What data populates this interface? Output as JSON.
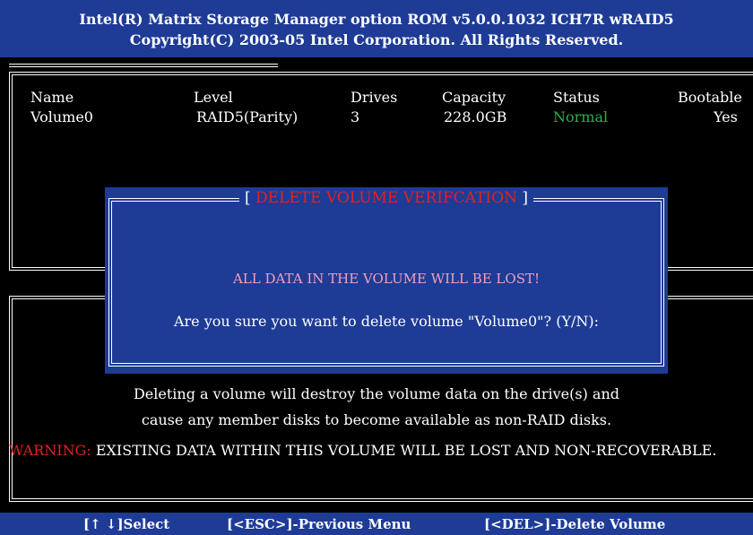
{
  "header": {
    "line1": "Intel(R) Matrix Storage Manager option ROM v5.0.0.1032 ICH7R wRAID5",
    "line2": "Copyright(C) 2003-05 Intel Corporation. All Rights Reserved."
  },
  "table": {
    "columns": [
      "Name",
      "Level",
      "Drives",
      "Capacity",
      "Status",
      "Bootable"
    ],
    "rows": [
      {
        "name": "Volume0",
        "level": "RAID5(Parity)",
        "drives": "3",
        "capacity": "228.0GB",
        "status": "Normal",
        "bootable": "Yes"
      }
    ]
  },
  "dialog": {
    "title_open": "[ ",
    "title": "DELETE VOLUME VERIFCATION",
    "title_close": " ]",
    "warning": "ALL DATA IN THE VOLUME WILL BE LOST!",
    "question": "Are you sure you want to delete volume \"Volume0\"? (Y/N):"
  },
  "info": {
    "line1": "Deleting a volume will destroy the volume data on the drive(s) and",
    "line2": "cause any member disks to become available as non-RAID disks.",
    "warning_label": "WARNING:",
    "warning_text": " EXISTING DATA WITHIN THIS VOLUME WILL BE LOST AND NON-RECOVERABLE."
  },
  "footer": {
    "select": "[↑ ↓]Select",
    "esc": "[<ESC>]-Previous Menu",
    "del": "[<DEL>]-Delete Volume"
  },
  "colors": {
    "bios_blue": "#1e3b96",
    "status_normal": "#2bb14a",
    "danger_red": "#e02222",
    "warning_pink": "#f2a0b8"
  }
}
